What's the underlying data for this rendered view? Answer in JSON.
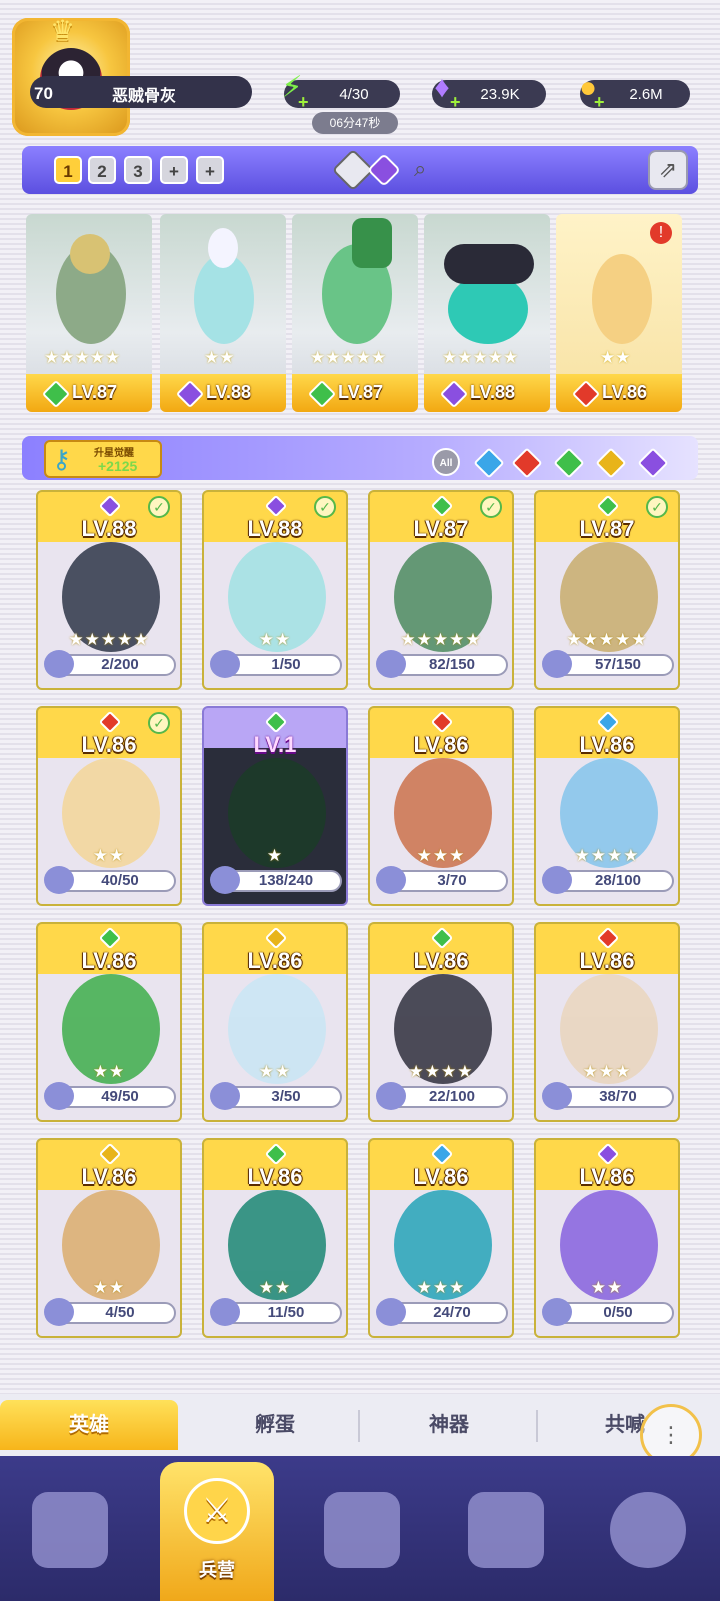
{
  "player": {
    "level": "70",
    "name": "恶贼骨灰"
  },
  "resources": {
    "energy": {
      "icon": "lightning-icon",
      "value": "4/30",
      "timer": "06分47秒"
    },
    "gems": {
      "icon": "gem-icon",
      "value": "23.9K"
    },
    "coins": {
      "icon": "coin-icon",
      "value": "2.6M"
    }
  },
  "team_tabs": [
    "1",
    "2",
    "3",
    "+",
    "+"
  ],
  "team": [
    {
      "level": "LV.87",
      "stars": "★★★★★",
      "element": "#3fbf4a"
    },
    {
      "level": "LV.88",
      "stars": "★★",
      "element": "#8a4fe0"
    },
    {
      "level": "LV.87",
      "stars": "★★★★★",
      "element": "#3fbf4a"
    },
    {
      "level": "LV.88",
      "stars": "★★★★★",
      "element": "#8a4fe0"
    },
    {
      "level": "LV.86",
      "stars": "★★",
      "element": "#e23a2a"
    }
  ],
  "filter": {
    "key_title": "升星觉醒",
    "key_count": "+2125",
    "all_label": "All",
    "elements": [
      "#3aa6e8",
      "#e23a2a",
      "#3fbf4a",
      "#e8b41a",
      "#8a4fe0"
    ]
  },
  "heroes": [
    {
      "level": "LV.88",
      "stars": "★★★★★",
      "progress": "2/200",
      "element": "#8a4fe0",
      "check": true
    },
    {
      "level": "LV.88",
      "stars": "★★",
      "progress": "1/50",
      "element": "#8a4fe0",
      "check": true
    },
    {
      "level": "LV.87",
      "stars": "★★★★★",
      "progress": "82/150",
      "element": "#3fbf4a",
      "check": true
    },
    {
      "level": "LV.87",
      "stars": "★★★★★",
      "progress": "57/150",
      "element": "#3fbf4a",
      "check": true
    },
    {
      "level": "LV.86",
      "stars": "★★",
      "progress": "40/50",
      "element": "#e23a2a",
      "check": true
    },
    {
      "level": "LV.1",
      "stars": "★",
      "progress": "138/240",
      "element": "#3fbf4a",
      "check": false
    },
    {
      "level": "LV.86",
      "stars": "★★★",
      "progress": "3/70",
      "element": "#e23a2a",
      "check": false
    },
    {
      "level": "LV.86",
      "stars": "★★★★",
      "progress": "28/100",
      "element": "#3aa6e8",
      "check": false
    },
    {
      "level": "LV.86",
      "stars": "★★",
      "progress": "49/50",
      "element": "#3fbf4a",
      "check": false
    },
    {
      "level": "LV.86",
      "stars": "★★",
      "progress": "3/50",
      "element": "#e8b41a",
      "check": false
    },
    {
      "level": "LV.86",
      "stars": "★★★★",
      "progress": "22/100",
      "element": "#3fbf4a",
      "check": false
    },
    {
      "level": "LV.86",
      "stars": "★★★",
      "progress": "38/70",
      "element": "#e23a2a",
      "check": false
    },
    {
      "level": "LV.86",
      "stars": "★★",
      "progress": "4/50",
      "element": "#e8b41a",
      "check": false
    },
    {
      "level": "LV.86",
      "stars": "★★",
      "progress": "11/50",
      "element": "#3fbf4a",
      "check": false
    },
    {
      "level": "LV.86",
      "stars": "★★★",
      "progress": "24/70",
      "element": "#3aa6e8",
      "check": false
    },
    {
      "level": "LV.86",
      "stars": "★★",
      "progress": "0/50",
      "element": "#8a4fe0",
      "check": false
    }
  ],
  "sub_tabs": [
    "英雄",
    "孵蛋",
    "神器",
    "共喊"
  ],
  "nav": {
    "barracks_label": "兵营"
  }
}
